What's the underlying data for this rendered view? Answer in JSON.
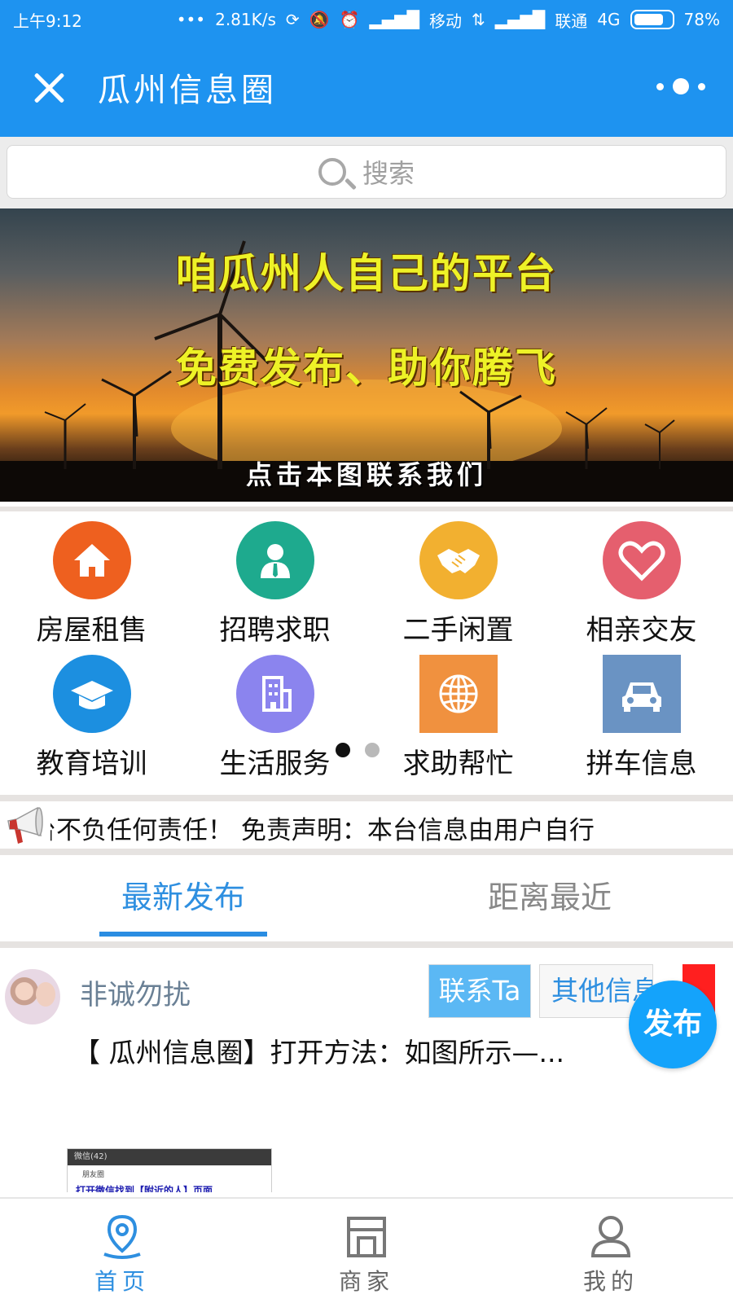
{
  "status_bar": {
    "time": "上午9:12",
    "speed": "2.81K/s",
    "carrier1": "移动",
    "carrier2": "联通",
    "network": "4G",
    "battery": "78%",
    "battery_level": 0.78
  },
  "header": {
    "title": "瓜州信息圈"
  },
  "search": {
    "placeholder": "搜索"
  },
  "banner": {
    "line1": "咱瓜州人自己的平台",
    "line2": "免费发布、助你腾飞",
    "line3": "点击本图联系我们"
  },
  "categories": [
    {
      "label": "房屋租售",
      "icon": "house-icon",
      "color": "#EE601F"
    },
    {
      "label": "招聘求职",
      "icon": "person-icon",
      "color": "#1EAA8E"
    },
    {
      "label": "二手闲置",
      "icon": "handshake-icon",
      "color": "#F2B030"
    },
    {
      "label": "相亲交友",
      "icon": "heart-icon",
      "color": "#E55F6E"
    },
    {
      "label": "教育培训",
      "icon": "graduation-cap-icon",
      "color": "#1C8FE0"
    },
    {
      "label": "生活服务",
      "icon": "building-icon",
      "color": "#8B84EE"
    },
    {
      "label": "求助帮忙",
      "icon": "globe-icon",
      "color": "#F0913F"
    },
    {
      "label": "拼车信息",
      "icon": "car-icon",
      "color": "#6A93C3"
    }
  ],
  "pager": {
    "current": 1,
    "total": 2
  },
  "notice": {
    "text": "台不负任何责任！           免责声明：本台信息由用户自行"
  },
  "tabs": [
    {
      "label": "最新发布",
      "active": true
    },
    {
      "label": "距离最近",
      "active": false
    }
  ],
  "post": {
    "user": "非诚勿扰",
    "contact_label": "联系Ta",
    "other_label": "其他信息",
    "text": "【 瓜州信息圈】打开方法：如图所示—...",
    "thumb_bar": "微信(42)",
    "thumb_row": "朋友圈",
    "thumb_caption": "打开微信找到【附近的人】页面"
  },
  "fab": {
    "label": "发布"
  },
  "bottom_nav": [
    {
      "label": "首页",
      "icon": "location-pin-icon",
      "active": true
    },
    {
      "label": "商家",
      "icon": "store-icon",
      "active": false
    },
    {
      "label": "我的",
      "icon": "user-icon",
      "active": false
    }
  ],
  "colors": {
    "brand": "#1E93F0",
    "accent": "#2E8FE0",
    "fab": "#14A3FB"
  }
}
